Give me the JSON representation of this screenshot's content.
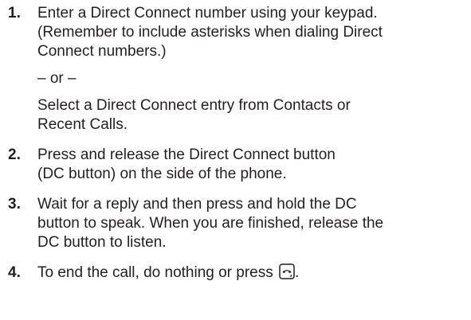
{
  "steps": [
    {
      "number": "1.",
      "lines": [
        "Enter a Direct Connect number using your keypad.",
        "(Remember to include asterisks when dialing Direct",
        "Connect numbers.)"
      ],
      "separator": "– or –",
      "alt_lines": [
        "Select a Direct Connect entry from Contacts or",
        "Recent Calls."
      ]
    },
    {
      "number": "2.",
      "lines": [
        "Press and release the Direct Connect button",
        "(DC button) on the side of the phone."
      ]
    },
    {
      "number": "3.",
      "lines": [
        "Wait for a reply and then press and hold the DC",
        "button to speak. When you are finished, release the",
        "DC button to listen."
      ]
    },
    {
      "number": "4.",
      "text": "To end the call, do nothing or press",
      "icon": "end-call-key-icon",
      "end_punct": "."
    }
  ]
}
